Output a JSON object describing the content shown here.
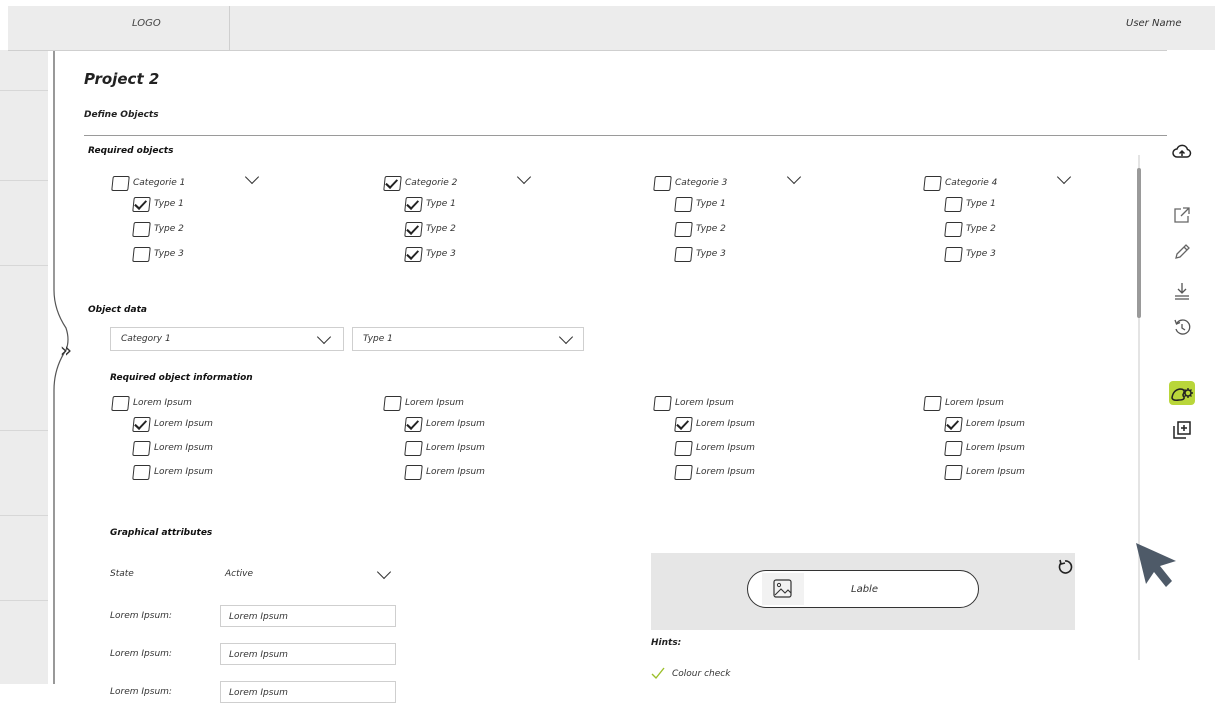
{
  "header": {
    "logo": "LOGO",
    "user_name": "User Name"
  },
  "page": {
    "project_title": "Project 2",
    "section_title": "Define Objects"
  },
  "required_objects": {
    "title": "Required objects",
    "categories": [
      {
        "label": "Categorie 1",
        "checked": false,
        "types": [
          {
            "label": "Type 1",
            "checked": true
          },
          {
            "label": "Type 2",
            "checked": false
          },
          {
            "label": "Type 3",
            "checked": false
          }
        ]
      },
      {
        "label": "Categorie 2",
        "checked": true,
        "types": [
          {
            "label": "Type 1",
            "checked": true
          },
          {
            "label": "Type 2",
            "checked": true
          },
          {
            "label": "Type 3",
            "checked": true
          }
        ]
      },
      {
        "label": "Categorie 3",
        "checked": false,
        "types": [
          {
            "label": "Type 1",
            "checked": false
          },
          {
            "label": "Type 2",
            "checked": false
          },
          {
            "label": "Type 3",
            "checked": false
          }
        ]
      },
      {
        "label": "Categorie 4",
        "checked": false,
        "types": [
          {
            "label": "Type 1",
            "checked": false
          },
          {
            "label": "Type 2",
            "checked": false
          },
          {
            "label": "Type 3",
            "checked": false
          }
        ]
      }
    ]
  },
  "object_data": {
    "title": "Object data",
    "category_select": "Category 1",
    "type_select": "Type 1",
    "info_title": "Required object information",
    "groups": [
      {
        "label": "Lorem Ipsum",
        "checked": false,
        "items": [
          {
            "label": "Lorem Ipsum",
            "checked": true
          },
          {
            "label": "Lorem Ipsum",
            "checked": false
          },
          {
            "label": "Lorem Ipsum",
            "checked": false
          }
        ]
      },
      {
        "label": "Lorem Ipsum",
        "checked": false,
        "items": [
          {
            "label": "Lorem Ipsum",
            "checked": true
          },
          {
            "label": "Lorem Ipsum",
            "checked": false
          },
          {
            "label": "Lorem Ipsum",
            "checked": false
          }
        ]
      },
      {
        "label": "Lorem Ipsum",
        "checked": false,
        "items": [
          {
            "label": "Lorem Ipsum",
            "checked": true
          },
          {
            "label": "Lorem Ipsum",
            "checked": false
          },
          {
            "label": "Lorem Ipsum",
            "checked": false
          }
        ]
      },
      {
        "label": "Lorem Ipsum",
        "checked": false,
        "items": [
          {
            "label": "Lorem Ipsum",
            "checked": true
          },
          {
            "label": "Lorem Ipsum",
            "checked": false
          },
          {
            "label": "Lorem Ipsum",
            "checked": false
          }
        ]
      }
    ]
  },
  "graphical_attributes": {
    "title": "Graphical attributes",
    "state_label": "State",
    "state_value": "Active",
    "rows": [
      {
        "label": "Lorem Ipsum:",
        "value": "Lorem Ipsum"
      },
      {
        "label": "Lorem Ipsum:",
        "value": "Lorem Ipsum"
      },
      {
        "label": "Lorem Ipsum:",
        "value": "Lorem Ipsum"
      }
    ]
  },
  "preview": {
    "label_text": "Lable"
  },
  "hints": {
    "title": "Hints:",
    "items": [
      "Colour check"
    ]
  },
  "toolbar": {
    "icons": [
      "cloud-upload-icon",
      "external-link-icon",
      "pencil-icon",
      "download-icon",
      "history-icon",
      "palette-gear-icon",
      "add-layer-icon"
    ],
    "active_color": "#b9d63a"
  }
}
